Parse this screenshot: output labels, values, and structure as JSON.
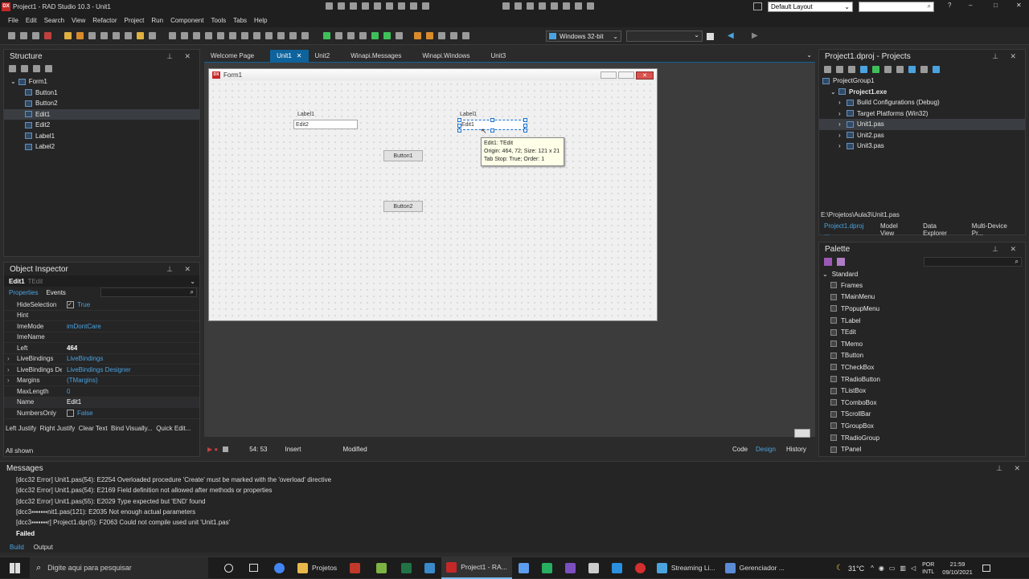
{
  "app": {
    "title": "Project1 - RAD Studio 10.3 - Unit1",
    "layout_select": "Default Layout",
    "help": "?",
    "window_controls": [
      "–",
      "□",
      "✕"
    ]
  },
  "menu": [
    "File",
    "Edit",
    "Search",
    "View",
    "Refactor",
    "Project",
    "Run",
    "Component",
    "Tools",
    "Tabs",
    "Help"
  ],
  "toolbar": {
    "platform": "Windows 32-bit",
    "config": ""
  },
  "structure": {
    "title": "Structure",
    "items": [
      {
        "label": "Form1",
        "level": 0
      },
      {
        "label": "Button1",
        "level": 1
      },
      {
        "label": "Button2",
        "level": 1
      },
      {
        "label": "Edit1",
        "level": 1,
        "selected": true
      },
      {
        "label": "Edit2",
        "level": 1
      },
      {
        "label": "Label1",
        "level": 1
      },
      {
        "label": "Label2",
        "level": 1
      }
    ]
  },
  "editor_tabs": [
    "Welcome Page",
    "Unit1",
    "Unit2",
    "Winapi.Messages",
    "Winapi.Windows",
    "Unit3"
  ],
  "form": {
    "title": "Form1",
    "label1a": "Label1",
    "label1b": "Label1",
    "edit2": "Edit2",
    "edit1": "Edit1",
    "button1": "Button1",
    "button2": "Button2",
    "tooltip": [
      "Edit1: TEdit",
      "Origin: 464, 72; Size: 121 x 21",
      "Tab Stop: True; Order: 1"
    ]
  },
  "object_inspector": {
    "title": "Object Inspector",
    "selected": "Edit1",
    "selected_type": "TEdit",
    "tabs": [
      "Properties",
      "Events"
    ],
    "properties": [
      {
        "name": "HideSelection",
        "value": "True",
        "check": true,
        "checked": true
      },
      {
        "name": "Hint",
        "value": ""
      },
      {
        "name": "ImeMode",
        "value": "imDontCare"
      },
      {
        "name": "ImeName",
        "value": ""
      },
      {
        "name": "Left",
        "value": "464",
        "bold": true
      },
      {
        "name": "LiveBindings",
        "value": "LiveBindings",
        "expand": true
      },
      {
        "name": "LiveBindings Des",
        "value": "LiveBindings Designer",
        "expand": true
      },
      {
        "name": "Margins",
        "value": "(TMargins)",
        "expand": true
      },
      {
        "name": "MaxLength",
        "value": "0"
      },
      {
        "name": "Name",
        "value": "Edit1",
        "white": true
      },
      {
        "name": "NumbersOnly",
        "value": "False",
        "check": true,
        "checked": false
      }
    ],
    "actions": "Left Justify  Right Justify  Clear Text  Bind Visually...  Quick Edit...",
    "status": "All shown"
  },
  "designer_status": {
    "position": "54: 53",
    "mode": "Insert",
    "modified": "Modified",
    "tabs": [
      "Code",
      "Design",
      "History"
    ]
  },
  "projects": {
    "title": "Project1.dproj - Projects",
    "items": [
      {
        "label": "ProjectGroup1",
        "level": 0
      },
      {
        "label": "Project1.exe",
        "level": 1,
        "bold": true
      },
      {
        "label": "Build Configurations (Debug)",
        "level": 2
      },
      {
        "label": "Target Platforms (Win32)",
        "level": 2
      },
      {
        "label": "Unit1.pas",
        "level": 2,
        "selected": true
      },
      {
        "label": "Unit2.pas",
        "level": 2
      },
      {
        "label": "Unit3.pas",
        "level": 2
      }
    ],
    "path": "E:\\Projetos\\Aula3\\Unit1.pas",
    "tabs": [
      "Project1.dproj ...",
      "Model View",
      "Data Explorer",
      "Multi-Device Pr..."
    ]
  },
  "palette": {
    "title": "Palette",
    "category": "Standard",
    "items": [
      "Frames",
      "TMainMenu",
      "TPopupMenu",
      "TLabel",
      "TEdit",
      "TMemo",
      "TButton",
      "TCheckBox",
      "TRadioButton",
      "TListBox",
      "TComboBox",
      "TScrollBar",
      "TGroupBox",
      "TRadioGroup",
      "TPanel"
    ]
  },
  "messages": {
    "title": "Messages",
    "lines": [
      "[dcc32 Error] Unit1.pas(54): E2254 Overloaded procedure 'Create' must be marked with the 'overload' directive",
      "[dcc32 Error] Unit1.pas(54): E2169 Field definition not allowed after methods or properties",
      "[dcc32 Error] Unit1.pas(55): E2029 Type expected but 'END' found",
      "[dcc3▪▪▪▪▪▪▪nit1.pas(121): E2035 Not enough actual parameters",
      "[dcc3▪▪▪▪▪▪▪r] Project1.dpr(5): F2063 Could not compile used unit 'Unit1.pas'"
    ],
    "failed": "Failed",
    "tabs": [
      "Build",
      "Output"
    ]
  },
  "taskbar": {
    "search": "Digite aqui para pesquisar",
    "tasks": [
      "Projetos",
      "Project1 - RA...",
      "Streaming Li...",
      "Gerenciador ..."
    ],
    "temp": "31°C",
    "lang1": "POR",
    "lang2": "INTL",
    "time": "21:59",
    "date": "09/10/2021"
  }
}
